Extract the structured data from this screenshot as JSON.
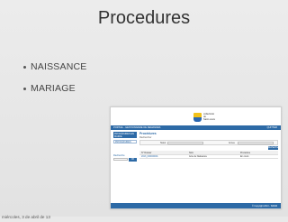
{
  "slide": {
    "title": "Procedures",
    "bullets": [
      "NAISSANCE",
      "MARIAGE"
    ],
    "footer": "miércoles, 3 de abril de 13"
  },
  "embedded_app": {
    "logo_text": [
      "collectivité",
      "de",
      "Saint-Louis"
    ],
    "topbar_left": "PORTAIL - GESTIONNAIRE DE DEMANDES",
    "topbar_right": "QUITTER",
    "menu": [
      {
        "label": "PROCÉDURES EN MAIRIE"
      },
      {
        "label": "PROCÉDURES"
      }
    ],
    "side_label": "Recherche",
    "side_button": "OK",
    "heading": "Procédures",
    "subheading": "Rechercher",
    "filter": {
      "label1": "Statut",
      "label2": "Année"
    },
    "search_button": "Rechercher",
    "table": {
      "columns": [
        "N° Dossier",
        "Nom",
        "Procédure"
      ],
      "rows": [
        [
          "2013_000000001",
          "Acte de Naissance",
          "En cours"
        ]
      ]
    },
    "bottombar": "© Copyright 2013 - SIPAM",
    "colors": {
      "accent": "#2d6aa6"
    }
  }
}
